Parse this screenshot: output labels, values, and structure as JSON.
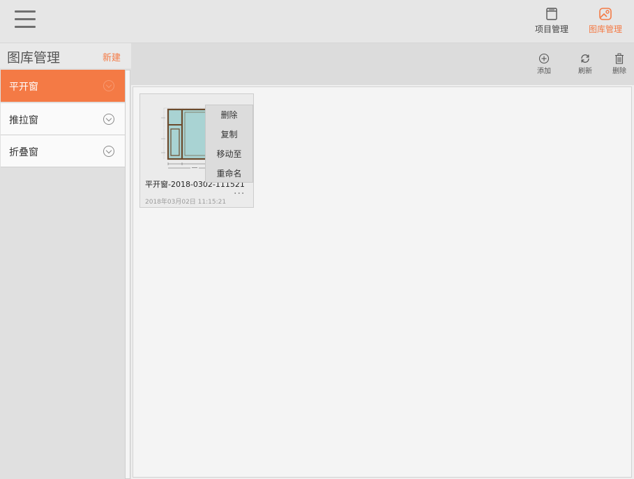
{
  "topbar": {
    "nav": [
      {
        "label": "项目管理",
        "icon": "project-icon",
        "active": false
      },
      {
        "label": "图库管理",
        "icon": "gallery-icon",
        "active": true
      }
    ]
  },
  "sidebar": {
    "title": "图库管理",
    "new_label": "新建",
    "items": [
      {
        "label": "平开窗",
        "active": true
      },
      {
        "label": "推拉窗",
        "active": false
      },
      {
        "label": "折叠窗",
        "active": false
      }
    ]
  },
  "toolbar": {
    "add_label": "添加",
    "refresh_label": "刷新",
    "delete_label": "删除"
  },
  "card": {
    "name": "平开窗-2018-0302-111521",
    "date": "2018年03月02日 11:15:21",
    "more": "···"
  },
  "context_menu": {
    "items": [
      "删除",
      "复制",
      "移动至",
      "重命名"
    ]
  },
  "colors": {
    "accent": "#f47a45",
    "glass": "#a9d3d3",
    "frame": "#6b4a2c"
  }
}
